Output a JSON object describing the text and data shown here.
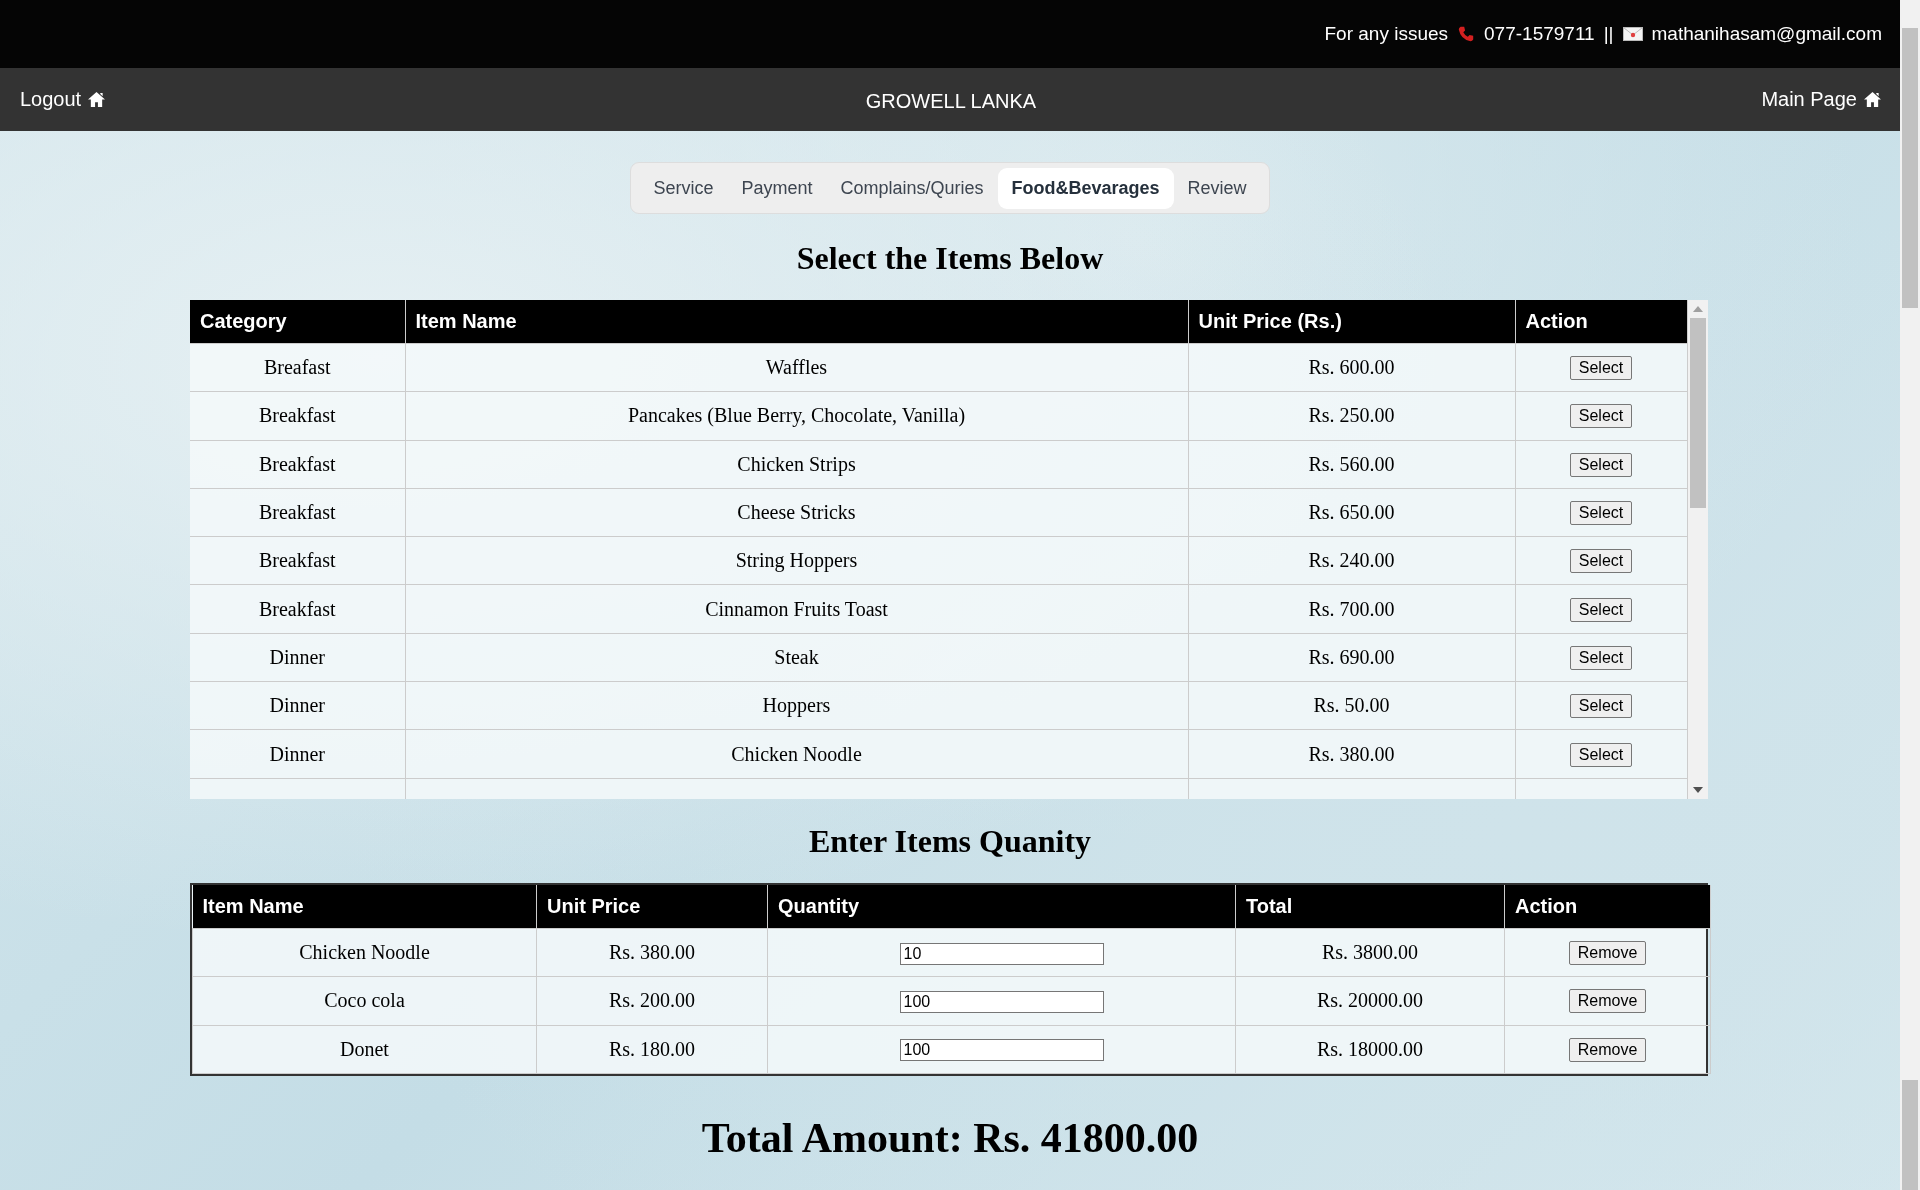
{
  "contact": {
    "label": "For any issues",
    "phone": "077-1579711",
    "separator": "||",
    "email": "mathanihasam@gmail.com"
  },
  "nav": {
    "logout": "Logout",
    "brand": "GROWELL LANKA",
    "main_page": "Main Page"
  },
  "tabs": [
    {
      "label": "Service",
      "selected": false
    },
    {
      "label": "Payment",
      "selected": false
    },
    {
      "label": "Complains/Quries",
      "selected": false
    },
    {
      "label": "Food&Bevarages",
      "selected": true
    },
    {
      "label": "Review",
      "selected": false
    }
  ],
  "items_heading": "Select the Items Below",
  "items_table": {
    "columns": [
      "Category",
      "Item Name",
      "Unit Price (Rs.)",
      "Action"
    ],
    "rows": [
      {
        "category": "Breafast",
        "item_name": "Waffles",
        "unit_price": "Rs. 600.00",
        "action": "Select"
      },
      {
        "category": "Breakfast",
        "item_name": "Pancakes (Blue Berry, Chocolate, Vanilla)",
        "unit_price": "Rs. 250.00",
        "action": "Select"
      },
      {
        "category": "Breakfast",
        "item_name": "Chicken Strips",
        "unit_price": "Rs. 560.00",
        "action": "Select"
      },
      {
        "category": "Breakfast",
        "item_name": "Cheese Stricks",
        "unit_price": "Rs. 650.00",
        "action": "Select"
      },
      {
        "category": "Breakfast",
        "item_name": "String Hoppers",
        "unit_price": "Rs. 240.00",
        "action": "Select"
      },
      {
        "category": "Breakfast",
        "item_name": "Cinnamon Fruits Toast",
        "unit_price": "Rs. 700.00",
        "action": "Select"
      },
      {
        "category": "Dinner",
        "item_name": "Steak",
        "unit_price": "Rs. 690.00",
        "action": "Select"
      },
      {
        "category": "Dinner",
        "item_name": "Hoppers",
        "unit_price": "Rs. 50.00",
        "action": "Select"
      },
      {
        "category": "Dinner",
        "item_name": "Chicken Noodle",
        "unit_price": "Rs. 380.00",
        "action": "Select"
      }
    ]
  },
  "quantity_heading": "Enter Items Quanity",
  "quantity_table": {
    "columns": [
      "Item Name",
      "Unit Price",
      "Quantity",
      "Total",
      "Action"
    ],
    "rows": [
      {
        "item_name": "Chicken Noodle",
        "unit_price": "Rs. 380.00",
        "quantity": "10",
        "total": "Rs. 3800.00",
        "action": "Remove"
      },
      {
        "item_name": "Coco cola",
        "unit_price": "Rs. 200.00",
        "quantity": "100",
        "total": "Rs. 20000.00",
        "action": "Remove"
      },
      {
        "item_name": "Donet",
        "unit_price": "Rs. 180.00",
        "quantity": "100",
        "total": "Rs. 18000.00",
        "action": "Remove"
      }
    ]
  },
  "total_amount": "Total Amount: Rs. 41800.00"
}
